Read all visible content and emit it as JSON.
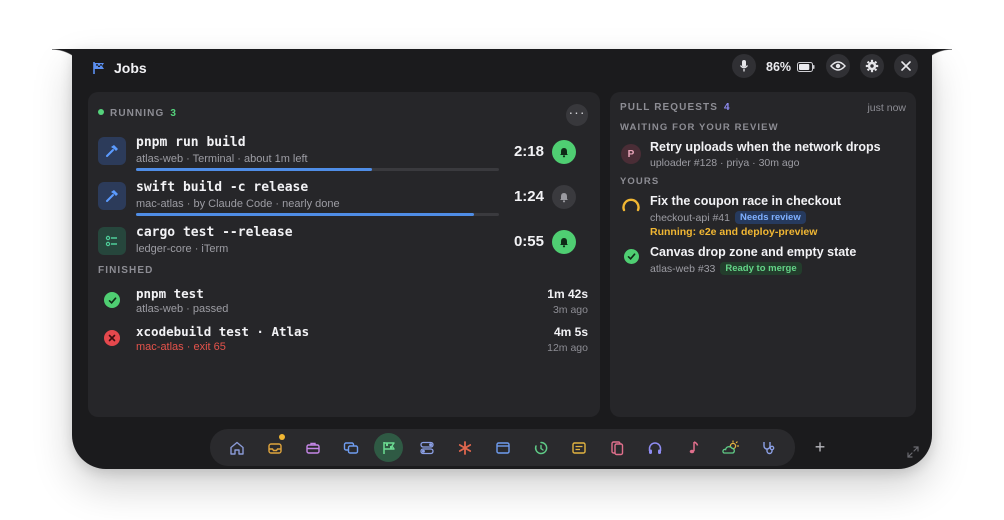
{
  "header": {
    "title": "Jobs",
    "battery_percent": "86%",
    "battery_level": 0.86
  },
  "running": {
    "label": "RUNNING",
    "count": "3",
    "jobs": [
      {
        "command": "pnpm run build",
        "meta": "atlas-web · Terminal · about 1m left",
        "time": "2:18",
        "progress": 0.65,
        "notify": true,
        "icon": "hammer-icon"
      },
      {
        "command": "swift build -c release",
        "meta": "mac-atlas · by Claude Code · nearly done",
        "time": "1:24",
        "progress": 0.93,
        "notify": false,
        "icon": "hammer-icon"
      },
      {
        "command": "cargo test --release",
        "meta": "ledger-core · iTerm",
        "time": "0:55",
        "progress": null,
        "notify": true,
        "icon": "checklist-icon"
      }
    ]
  },
  "finished": {
    "label": "FINISHED",
    "jobs": [
      {
        "command": "pnpm test",
        "meta": "atlas-web · passed",
        "duration": "1m 42s",
        "ago": "3m ago",
        "status": "passed"
      },
      {
        "command": "xcodebuild test · Atlas",
        "meta": "mac-atlas · exit 65",
        "duration": "4m 5s",
        "ago": "12m ago",
        "status": "failed"
      }
    ]
  },
  "pull_requests": {
    "label": "PULL REQUESTS",
    "count": "4",
    "updated": "just now",
    "waiting_label": "WAITING FOR YOUR REVIEW",
    "yours_label": "YOURS",
    "waiting": [
      {
        "title": "Retry uploads when the network drops",
        "meta": "uploader #128 · priya · 30m ago",
        "avatar": "P"
      }
    ],
    "yours": [
      {
        "title": "Fix the coupon race in checkout",
        "meta": "checkout-api #41",
        "badge": "Needs review",
        "running": "Running: e2e and deploy-preview"
      },
      {
        "title": "Canvas drop zone and empty state",
        "meta": "atlas-web #33",
        "badge": "Ready to merge"
      }
    ]
  },
  "dock": {
    "items": [
      "home-icon",
      "inbox-icon",
      "briefcase-icon",
      "windows-icon",
      "flag-icon",
      "toggles-icon",
      "asterisk-icon",
      "browser-window-icon",
      "timer-icon",
      "notes-icon",
      "cards-icon",
      "headphones-icon",
      "music-note-icon",
      "weather-icon",
      "stethoscope-icon"
    ],
    "active": "flag-icon",
    "colors": {
      "active_bg": "#2f5a44",
      "badge": "#f1b733"
    }
  },
  "colors": {
    "accent_blue": "#4f8de6",
    "green": "#4fce72",
    "red": "#e5484d",
    "amber": "#f1b733",
    "purple": "#8f8cf2"
  }
}
